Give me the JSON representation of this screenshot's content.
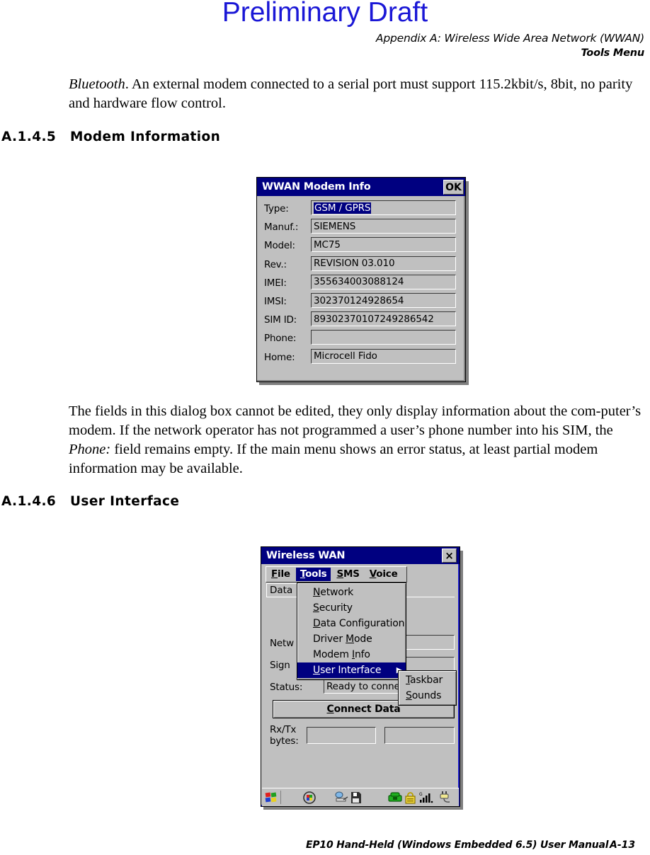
{
  "watermark": "Preliminary Draft",
  "running_header": {
    "line1": "Appendix A:  Wireless Wide Area Network (WWAN)",
    "line2": "Tools Menu"
  },
  "body": {
    "para1_italic": "Bluetooth",
    "para1_rest": ". An external modem connected to a serial port must support 115.2kbit/s, 8bit, no parity and hardware flow control.",
    "para2_part1": "The fields in this dialog box cannot be edited, they only display information about the com-puter’s modem. If the network operator has not programmed a user’s phone number into his SIM, the ",
    "para2_italic": "Phone:",
    "para2_part2": " field remains empty. If the main menu shows an error status, at least partial modem information may be available."
  },
  "headings": {
    "h5_num": "A.1.4.5",
    "h5_text": "Modem Information",
    "h6_num": "A.1.4.6",
    "h6_text": "User Interface"
  },
  "footer": {
    "title": "EP10 Hand-Held (Windows Embedded 6.5) User Manual",
    "page": "A-13"
  },
  "modem_info_dialog": {
    "title": "WWAN Modem Info",
    "ok_label": "OK",
    "fields": [
      {
        "label": "Type:",
        "value": "GSM / GPRS",
        "selected": true
      },
      {
        "label": "Manuf.:",
        "value": "SIEMENS",
        "selected": false
      },
      {
        "label": "Model:",
        "value": "MC75",
        "selected": false
      },
      {
        "label": "Rev.:",
        "value": "REVISION 03.010",
        "selected": false
      },
      {
        "label": "IMEI:",
        "value": "355634003088124",
        "selected": false
      },
      {
        "label": "IMSI:",
        "value": "302370124928654",
        "selected": false
      },
      {
        "label": "SIM ID:",
        "value": "89302370107249286542",
        "selected": false
      },
      {
        "label": "Phone:",
        "value": "",
        "selected": false
      },
      {
        "label": "Home:",
        "value": "Microcell Fido",
        "selected": false
      }
    ]
  },
  "wireless_wan_dialog": {
    "title": "Wireless WAN",
    "close_label": "×",
    "menubar": [
      {
        "label_pre": "",
        "accel": "F",
        "label_post": "ile",
        "active": false
      },
      {
        "label_pre": "",
        "accel": "T",
        "label_post": "ools",
        "active": true
      },
      {
        "label_pre": "",
        "accel": "S",
        "label_post": "MS",
        "active": false
      },
      {
        "label_pre": "",
        "accel": "V",
        "label_post": "oice",
        "active": false
      }
    ],
    "tab_label": "Data",
    "tools_menu": [
      {
        "pre": "",
        "accel": "N",
        "post": "etwork",
        "highlighted": false,
        "submenu": false
      },
      {
        "pre": "",
        "accel": "S",
        "post": "ecurity",
        "highlighted": false,
        "submenu": false
      },
      {
        "pre": "",
        "accel": "D",
        "post": "ata Configuration",
        "highlighted": false,
        "submenu": false
      },
      {
        "pre": "Driver ",
        "accel": "M",
        "post": "ode",
        "highlighted": false,
        "submenu": false
      },
      {
        "pre": "Modem ",
        "accel": "I",
        "post": "nfo",
        "highlighted": false,
        "submenu": false
      },
      {
        "pre": "",
        "accel": "U",
        "post": "ser Interface",
        "highlighted": true,
        "submenu": true
      }
    ],
    "user_interface_submenu": [
      {
        "pre": "",
        "accel": "T",
        "post": "askbar"
      },
      {
        "pre": "",
        "accel": "S",
        "post": "ounds"
      }
    ],
    "field_labels": {
      "network": "Netw",
      "signal": "Sign",
      "status": "Status:"
    },
    "status_value": "Ready to conne",
    "connect_button_pre": "",
    "connect_button_accel": "C",
    "connect_button_post": "onnect Data",
    "rxtx_label_line1": "Rx/Tx",
    "rxtx_label_line2": "bytes:",
    "rx_value": "",
    "tx_value": "",
    "taskbar_icons": [
      "start-flag-icon",
      "desktop-palette-icon",
      "network-connection-icon",
      "storage-card-icon",
      "phone-icon",
      "lock-icon",
      "signal-bars-icon",
      "power-plug-icon"
    ]
  },
  "colors": {
    "watermark": "#1a17d6",
    "titlebar": "#000080",
    "dialog_face": "#c0c0c0",
    "highlight": "#000080"
  }
}
